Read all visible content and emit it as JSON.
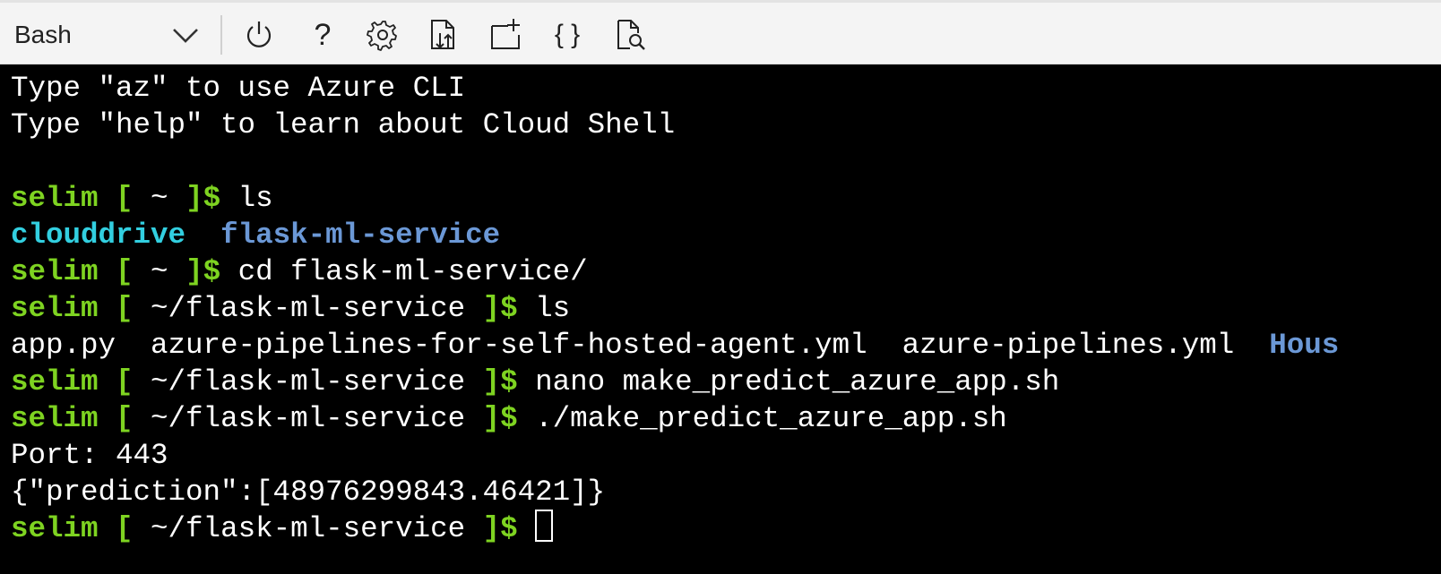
{
  "toolbar": {
    "shell_selected": "Bash",
    "icons": [
      "power-icon",
      "help-icon",
      "settings-icon",
      "upload-download-icon",
      "new-session-icon",
      "editor-braces-icon",
      "web-preview-icon"
    ],
    "help_glyph": "?",
    "braces_glyph": "{ }"
  },
  "terminal": {
    "colors": {
      "prompt": "#7ed321",
      "dir_cyan": "#32cfe0",
      "dir_blue": "#6b98d6",
      "text": "#ffffff",
      "background": "#000000"
    },
    "line1": "Type \"az\" to use Azure CLI",
    "line2": "Type \"help\" to learn about Cloud Shell",
    "prompt_user": "selim",
    "home_path": " ~ ",
    "project_path": " ~/flask-ml-service ",
    "open_bracket": " [",
    "close_bracket": "]$ ",
    "cmd_ls": "ls",
    "ls_home": [
      "clouddrive",
      "flask-ml-service"
    ],
    "cmd_cd": "cd flask-ml-service/",
    "ls_project_files": "app.py  azure-pipelines-for-self-hosted-agent.yml  azure-pipelines.yml  ",
    "ls_project_dir_partial": "Hous",
    "cmd_nano": "nano make_predict_azure_app.sh",
    "cmd_run": "./make_predict_azure_app.sh",
    "out_port": "Port: 443",
    "out_prediction": "{\"prediction\":[48976299843.46421]}"
  }
}
